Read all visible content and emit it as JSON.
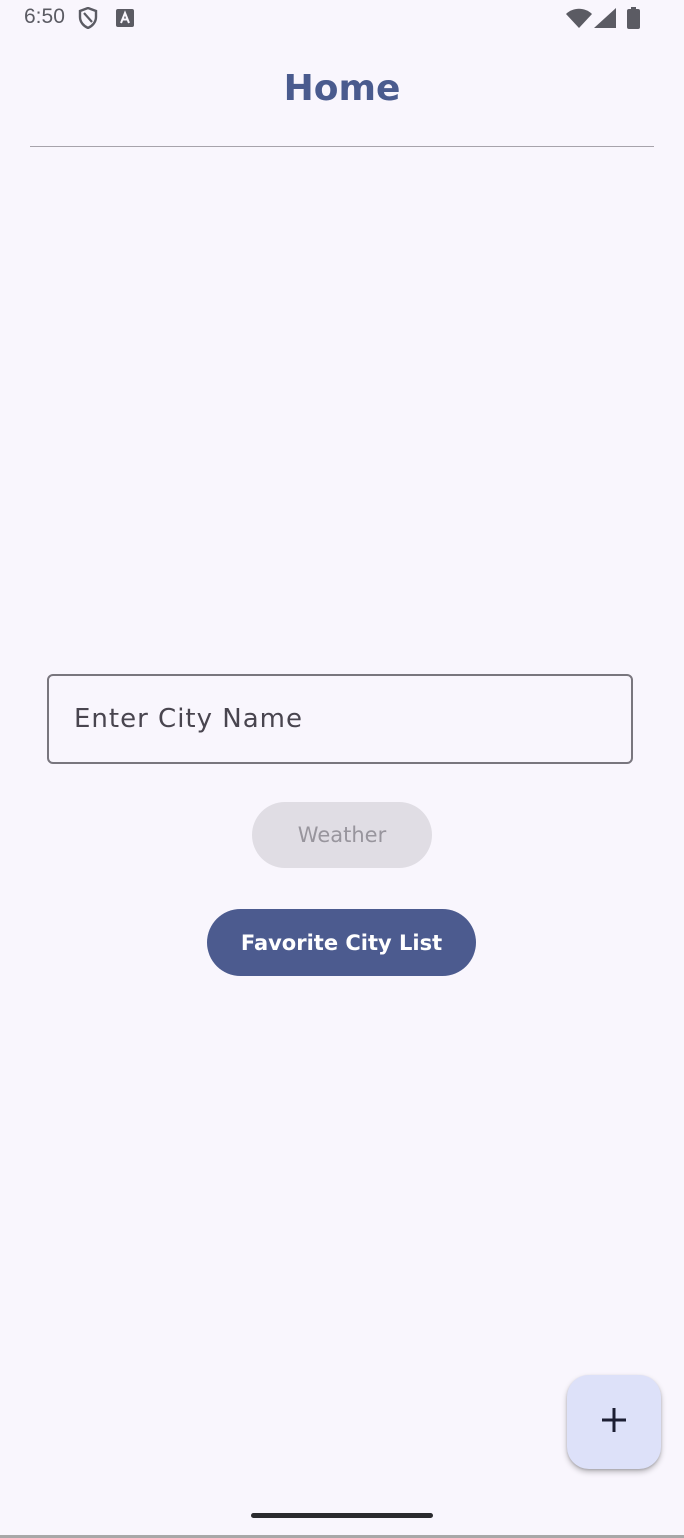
{
  "status_bar": {
    "time": "6:50",
    "left_icons": [
      "shield-icon",
      "text-a-icon"
    ],
    "right_icons": [
      "wifi-icon",
      "cell-signal-icon",
      "battery-icon"
    ]
  },
  "app_bar": {
    "title": "Home"
  },
  "form": {
    "city_input": {
      "placeholder": "Enter City Name",
      "value": ""
    },
    "weather_button_label": "Weather",
    "favorite_button_label": "Favorite City List"
  },
  "fab": {
    "icon": "plus-icon"
  },
  "colors": {
    "background": "#f9f6fd",
    "primary": "#4c5b8f",
    "title": "#4a5b8e",
    "disabled_button_bg": "#e0dde4",
    "disabled_button_text": "#98959d",
    "fab_bg": "#dde1f9"
  }
}
